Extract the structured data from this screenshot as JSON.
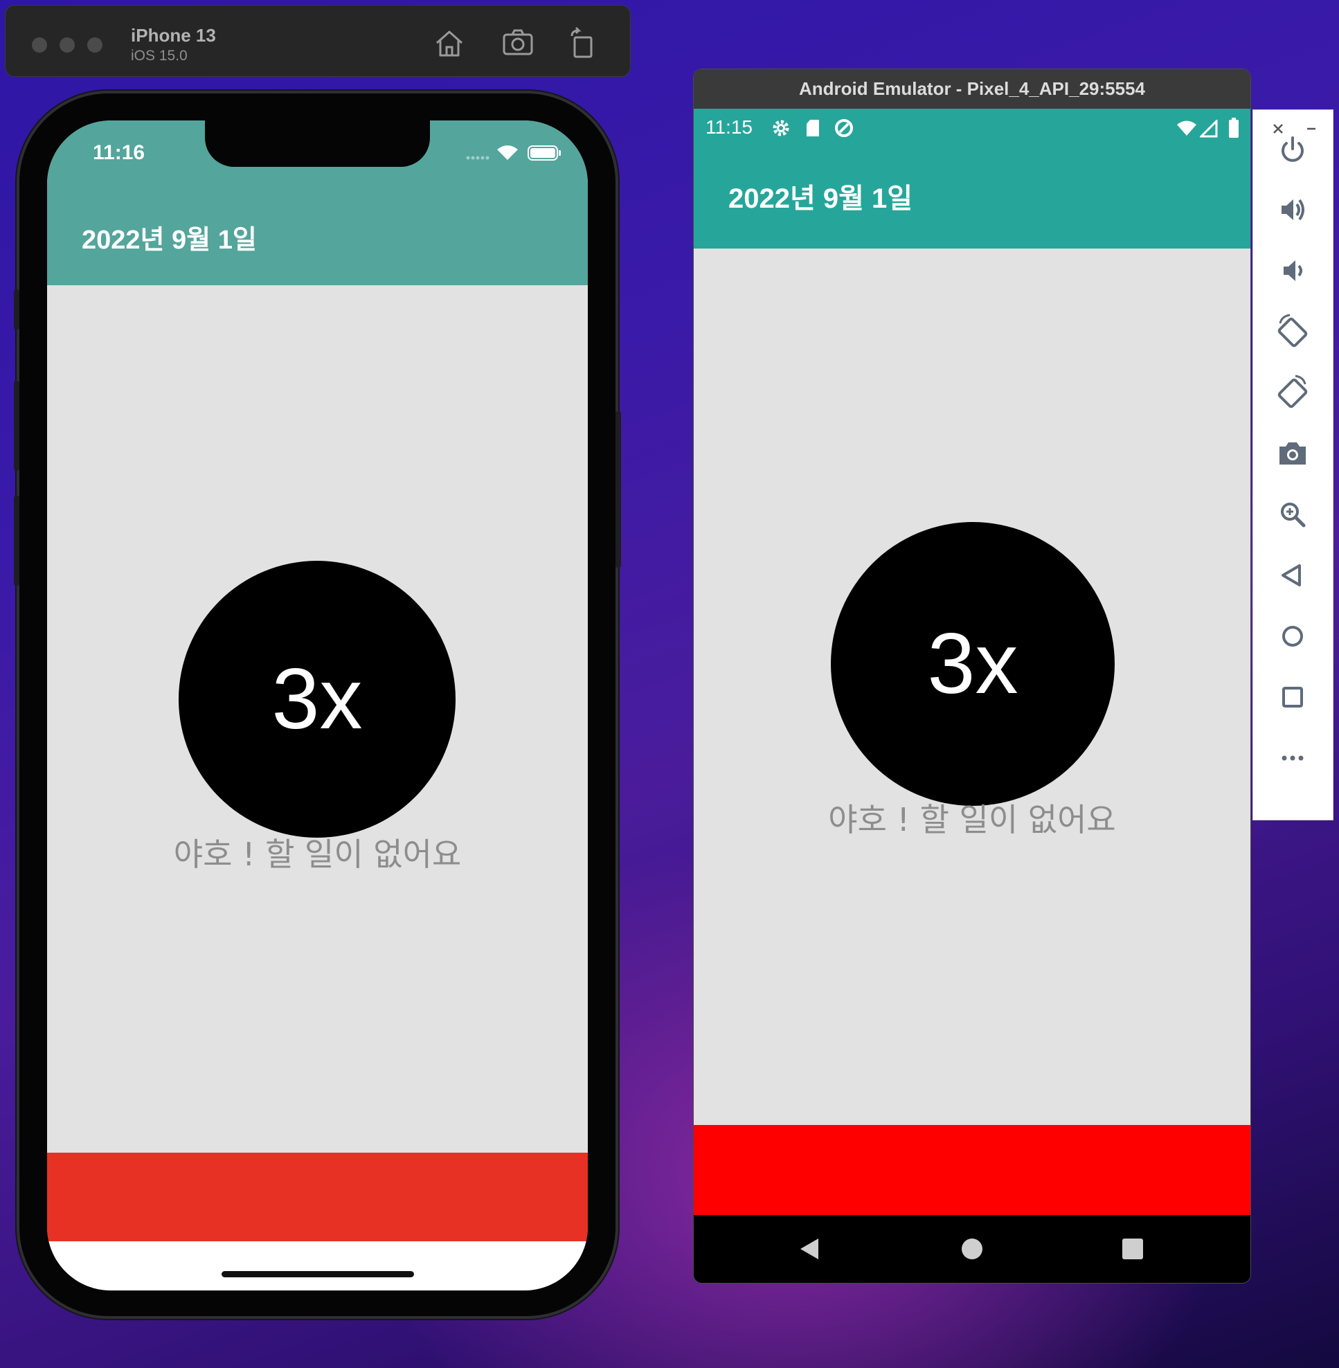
{
  "simulator": {
    "device_name": "iPhone 13",
    "os_version": "iOS 15.0",
    "toolbar": [
      "home-icon",
      "screenshot-icon",
      "rotate-icon"
    ]
  },
  "ios_app": {
    "status_time": "11:16",
    "header_date": "2022년 9월 1일",
    "circle_label": "3x",
    "empty_message": "야호 ! 할 일이 없어요",
    "header_color": "#54a59c",
    "footer_color": "#e73125"
  },
  "emulator": {
    "window_title": "Android Emulator - Pixel_4_API_29:5554",
    "status_time": "11:15",
    "header_date": "2022년 9월 1일",
    "circle_label": "3x",
    "empty_message": "야호 ! 할 일이 없어요",
    "header_color": "#26a69a",
    "footer_color": "#ff0000",
    "side_toolbar": [
      "close-icon",
      "minimize-icon",
      "power-icon",
      "volume-up-icon",
      "volume-down-icon",
      "rotate-left-icon",
      "rotate-right-icon",
      "camera-icon",
      "zoom-icon",
      "back-icon",
      "home-icon",
      "overview-icon",
      "more-icon"
    ]
  }
}
